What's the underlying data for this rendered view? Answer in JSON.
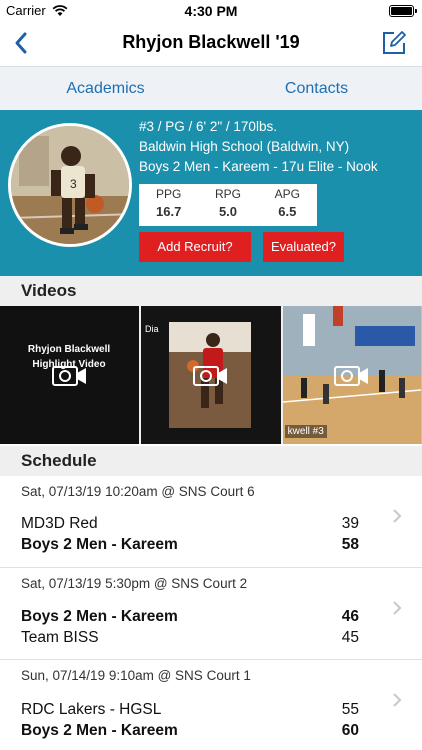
{
  "status": {
    "carrier": "Carrier",
    "time": "4:30 PM"
  },
  "nav": {
    "title": "Rhyjon Blackwell '19"
  },
  "tabs": [
    "Academics",
    "Contacts"
  ],
  "profile": {
    "line1": "#3 / PG / 6' 2\" / 170lbs.",
    "line2": "Baldwin High School (Baldwin, NY)",
    "line3": "Boys 2 Men - Kareem - 17u Elite - Nook",
    "stats": [
      {
        "label": "PPG",
        "value": "16.7"
      },
      {
        "label": "RPG",
        "value": "5.0"
      },
      {
        "label": "APG",
        "value": "6.5"
      }
    ],
    "add_button": "Add Recruit?",
    "evaluated_button": "Evaluated?"
  },
  "videos": {
    "heading": "Videos",
    "items": [
      {
        "title": "Rhyjon Blackwell Highlight Video"
      },
      {
        "title": ""
      },
      {
        "title": "kwell #3"
      }
    ]
  },
  "schedule": {
    "heading": "Schedule",
    "games": [
      {
        "meta": "Sat, 07/13/19 10:20am @ SNS Court 6",
        "team1": "MD3D Red",
        "score1": "39",
        "team2": "Boys 2 Men - Kareem",
        "score2": "58",
        "bold": 2
      },
      {
        "meta": "Sat, 07/13/19 5:30pm @ SNS Court 2",
        "team1": "Boys 2 Men - Kareem",
        "score1": "46",
        "team2": "Team BISS",
        "score2": "45",
        "bold": 1
      },
      {
        "meta": "Sun, 07/14/19 9:10am @ SNS Court 1",
        "team1": "RDC Lakers - HGSL",
        "score1": "55",
        "team2": "Boys 2 Men - Kareem",
        "score2": "60",
        "bold": 2
      }
    ]
  }
}
